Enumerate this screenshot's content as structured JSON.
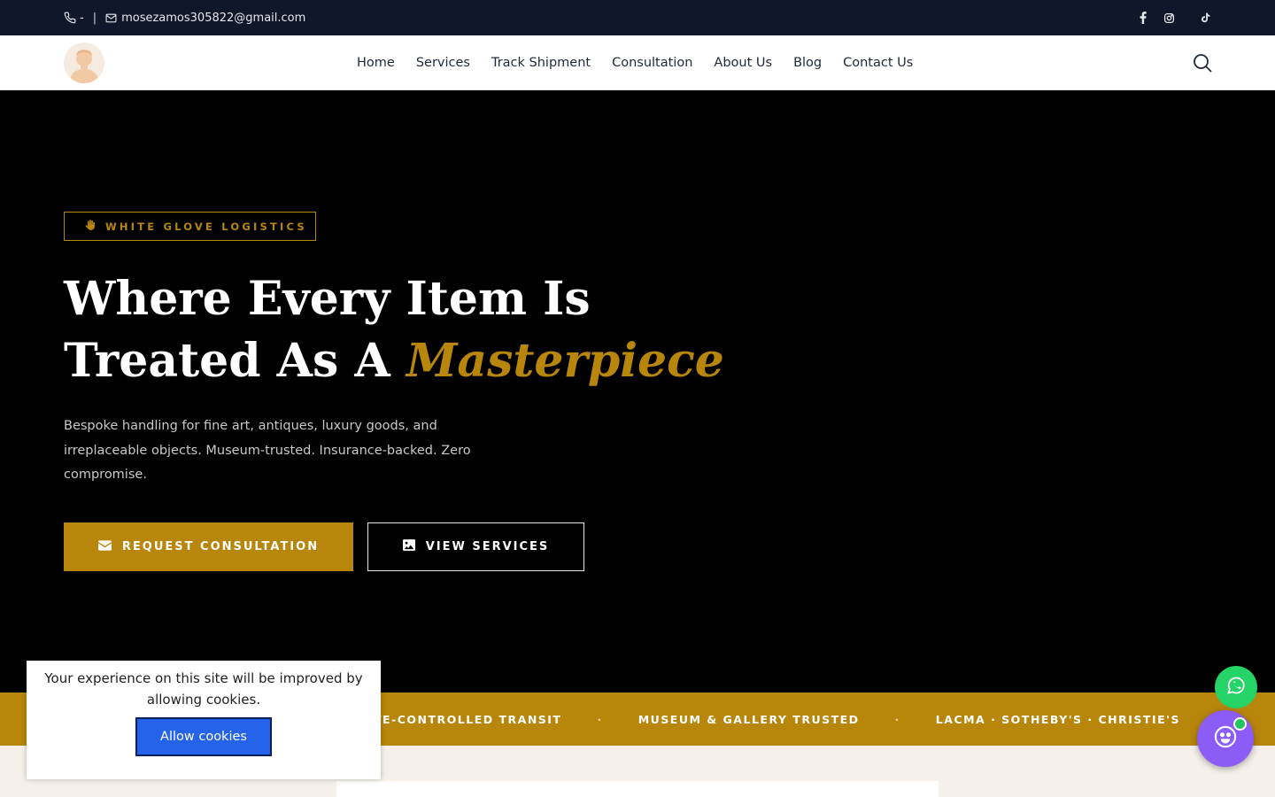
{
  "topbar": {
    "phone": "-",
    "separator": "|",
    "email": "mosezamos305822@gmail.com",
    "social_icons": [
      "facebook-icon",
      "instagram-icon",
      "tiktok-icon"
    ]
  },
  "nav": {
    "items": [
      "Home",
      "Services",
      "Track Shipment",
      "Consultation",
      "About Us",
      "Blog",
      "Contact Us"
    ]
  },
  "hero": {
    "tag": "WHITE GLOVE LOGISTICS",
    "headline_line1": "Where Every Item Is",
    "headline_line2_start": "Treated As A",
    "headline_accent": "Masterpiece",
    "subtext": "Bespoke handling for fine art, antiques, luxury goods, and irreplaceable objects. Museum-trusted. Insurance-backed. Zero compromise.",
    "primary_button": "REQUEST CONSULTATION",
    "secondary_button": "VIEW SERVICES"
  },
  "ticker": {
    "items": [
      "TE-CONTROLLED TRANSIT",
      "MUSEUM & GALLERY TRUSTED",
      "LACMA · SOTHEBY'S · CHRISTIE'S"
    ],
    "dot": "·"
  },
  "cookie": {
    "message": "Your experience on this site will be improved by allowing cookies.",
    "button": "Allow cookies"
  },
  "colors": {
    "gold": "#b8860b",
    "topbar": "#0f172a",
    "whatsapp": "#25d366",
    "chatbot": "#8b5cf6",
    "cookie_button": "#2563eb"
  }
}
